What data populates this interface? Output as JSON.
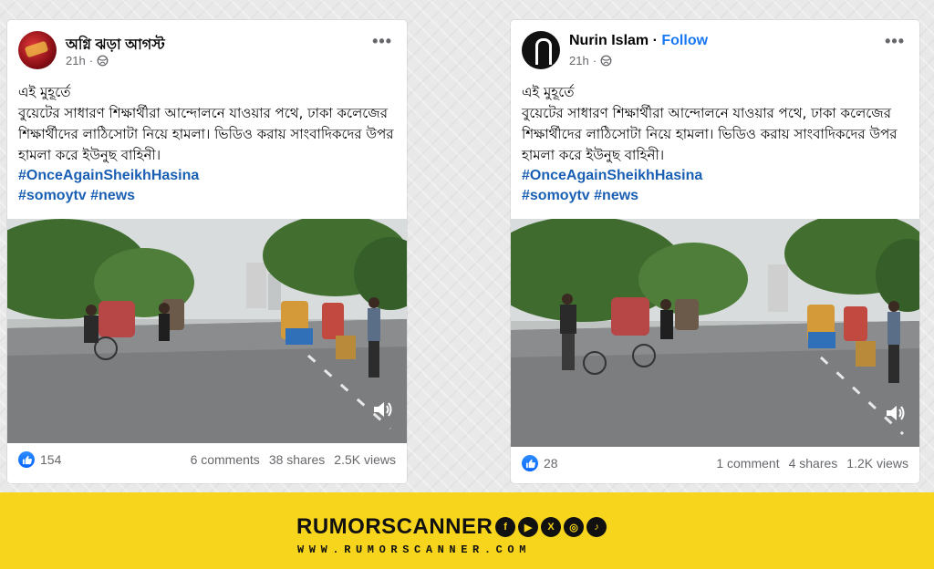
{
  "posts": [
    {
      "author": "অগ্নি ঝড়া আগস্ট",
      "follow_label": "",
      "time": "21h",
      "line1": "এই মুহূর্তে",
      "body": "বুয়েটের সাধারণ শিক্ষার্থীরা আন্দোলনে যাওয়ার পথে, ঢাকা কলেজের শিক্ষার্থীদের লাঠিসোটা নিয়ে হামলা। ভিডিও করায় সাংবাদিকদের উপর হামলা করে ইউনুছ বাহিনী।",
      "hashtag1": "#OnceAgainSheikhHasina",
      "hashtag2": "#somoytv #news",
      "reactions": "154",
      "comments": "6 comments",
      "shares": "38 shares",
      "views": "2.5K views"
    },
    {
      "author": "Nurin Islam",
      "follow_label": "Follow",
      "time": "21h",
      "line1": "এই মুহূর্তে",
      "body": "বুয়েটের সাধারণ শিক্ষার্থীরা আন্দোলনে যাওয়ার পথে, ঢাকা কলেজের শিক্ষার্থীদের লাঠিসোটা নিয়ে হামলা। ভিডিও করায় সাংবাদিকদের উপর হামলা করে ইউনুছ বাহিনী।",
      "hashtag1": "#OnceAgainSheikhHasina",
      "hashtag2": "#somoytv #news",
      "reactions": "28",
      "comments": "1 comment",
      "shares": "4 shares",
      "views": "1.2K views"
    }
  ],
  "banner": {
    "brand": "RUMORSCANNER",
    "url": "WWW.RUMORSCANNER.COM",
    "social_icons": [
      "facebook-icon",
      "youtube-icon",
      "x-icon",
      "instagram-icon",
      "tiktok-icon"
    ]
  },
  "colors": {
    "link_blue": "#1a5fb4",
    "follow_blue": "#1877f2",
    "banner_yellow": "#f7d51d"
  }
}
